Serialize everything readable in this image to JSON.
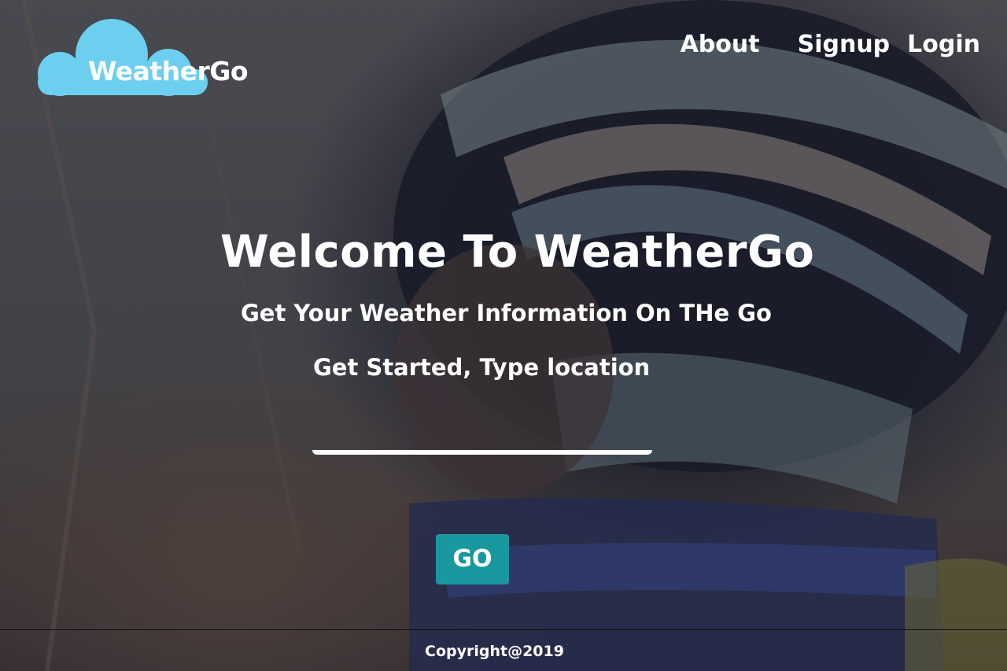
{
  "brand": {
    "name": "WeatherGo",
    "cloud_color": "#6ccff0"
  },
  "nav": {
    "about": "About",
    "signup": "Signup",
    "login": "Login"
  },
  "hero": {
    "title": "Welcome To WeatherGo",
    "subtitle": "Get Your Weather Information On THe Go",
    "cta": "Get Started, Type location"
  },
  "search": {
    "value": "",
    "placeholder": ""
  },
  "go_button": {
    "label": "GO",
    "color": "#1a98a0"
  },
  "footer": {
    "copyright": "Copyright@2019"
  },
  "background": {
    "icon": "photo-child-knitted-hat"
  }
}
